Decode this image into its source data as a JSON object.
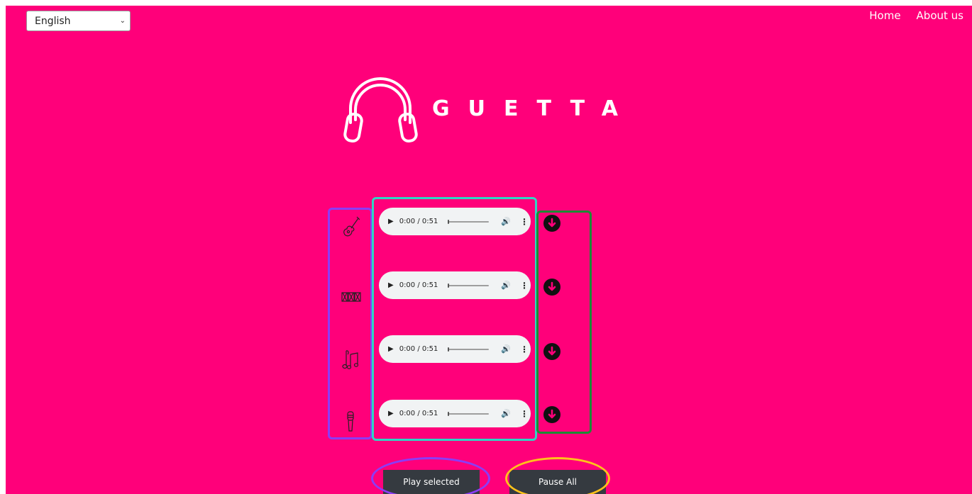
{
  "header": {
    "language_select": {
      "value": "English"
    },
    "nav": [
      {
        "label": "Home"
      },
      {
        "label": "About us"
      }
    ]
  },
  "logo": {
    "icon": "headphones-icon",
    "text": "GUETTA"
  },
  "tracks": [
    {
      "instrument_icon": "guitar-icon",
      "time": "0:00 / 0:51",
      "download_icon": "download-icon"
    },
    {
      "instrument_icon": "drums-icon",
      "time": "0:00 / 0:51",
      "download_icon": "download-icon"
    },
    {
      "instrument_icon": "music-notes-icon",
      "time": "0:00 / 0:51",
      "download_icon": "download-icon"
    },
    {
      "instrument_icon": "microphone-icon",
      "time": "0:00 / 0:51",
      "download_icon": "download-icon"
    }
  ],
  "controls": {
    "play_selected": "Play selected",
    "pause_all": "Pause All"
  },
  "colors": {
    "background": "#ff007a",
    "button": "#353a40",
    "highlight_icons": "#8b3cf7",
    "highlight_players": "#2ed6c4",
    "highlight_downloads": "#1c8a34",
    "highlight_pause": "#ffc21a"
  }
}
